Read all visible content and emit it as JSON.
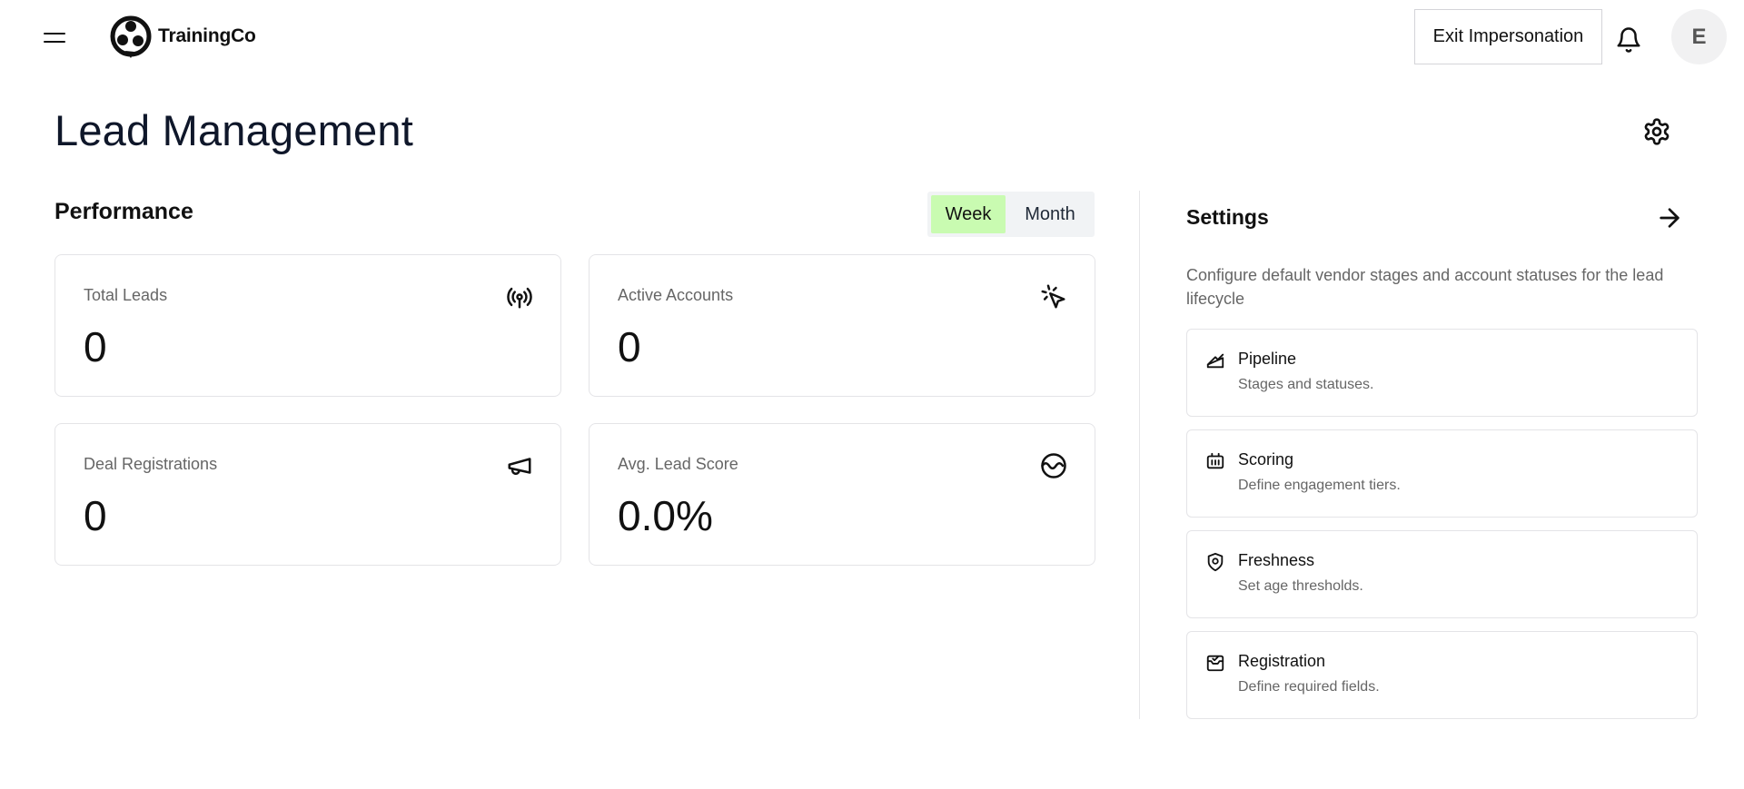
{
  "header": {
    "brand": "TrainingCo",
    "exit_label": "Exit Impersonation",
    "avatar_initial": "E"
  },
  "page": {
    "title": "Lead Management"
  },
  "performance": {
    "title": "Performance",
    "range_options": [
      "Week",
      "Month"
    ],
    "selected_range": "Week",
    "cards": [
      {
        "label": "Total Leads",
        "value": "0",
        "icon": "broadcast-icon"
      },
      {
        "label": "Active Accounts",
        "value": "0",
        "icon": "cursor-click-icon"
      },
      {
        "label": "Deal Registrations",
        "value": "0",
        "icon": "megaphone-icon"
      },
      {
        "label": "Avg. Lead Score",
        "value": "0.0%",
        "icon": "score-wave-icon"
      }
    ]
  },
  "settings": {
    "title": "Settings",
    "description": "Configure default vendor stages and account statuses for the lead lifecycle",
    "items": [
      {
        "name": "Pipeline",
        "desc": "Stages and statuses.",
        "icon": "pipeline-icon"
      },
      {
        "name": "Scoring",
        "desc": "Define engagement tiers.",
        "icon": "scoring-icon"
      },
      {
        "name": "Freshness",
        "desc": "Set age thresholds.",
        "icon": "freshness-icon"
      },
      {
        "name": "Registration",
        "desc": "Define required fields.",
        "icon": "registration-icon"
      }
    ]
  },
  "colors": {
    "active_toggle": "#c9fbb1",
    "text": "#0f172a",
    "muted": "#666666",
    "border": "#e4e4e7"
  }
}
